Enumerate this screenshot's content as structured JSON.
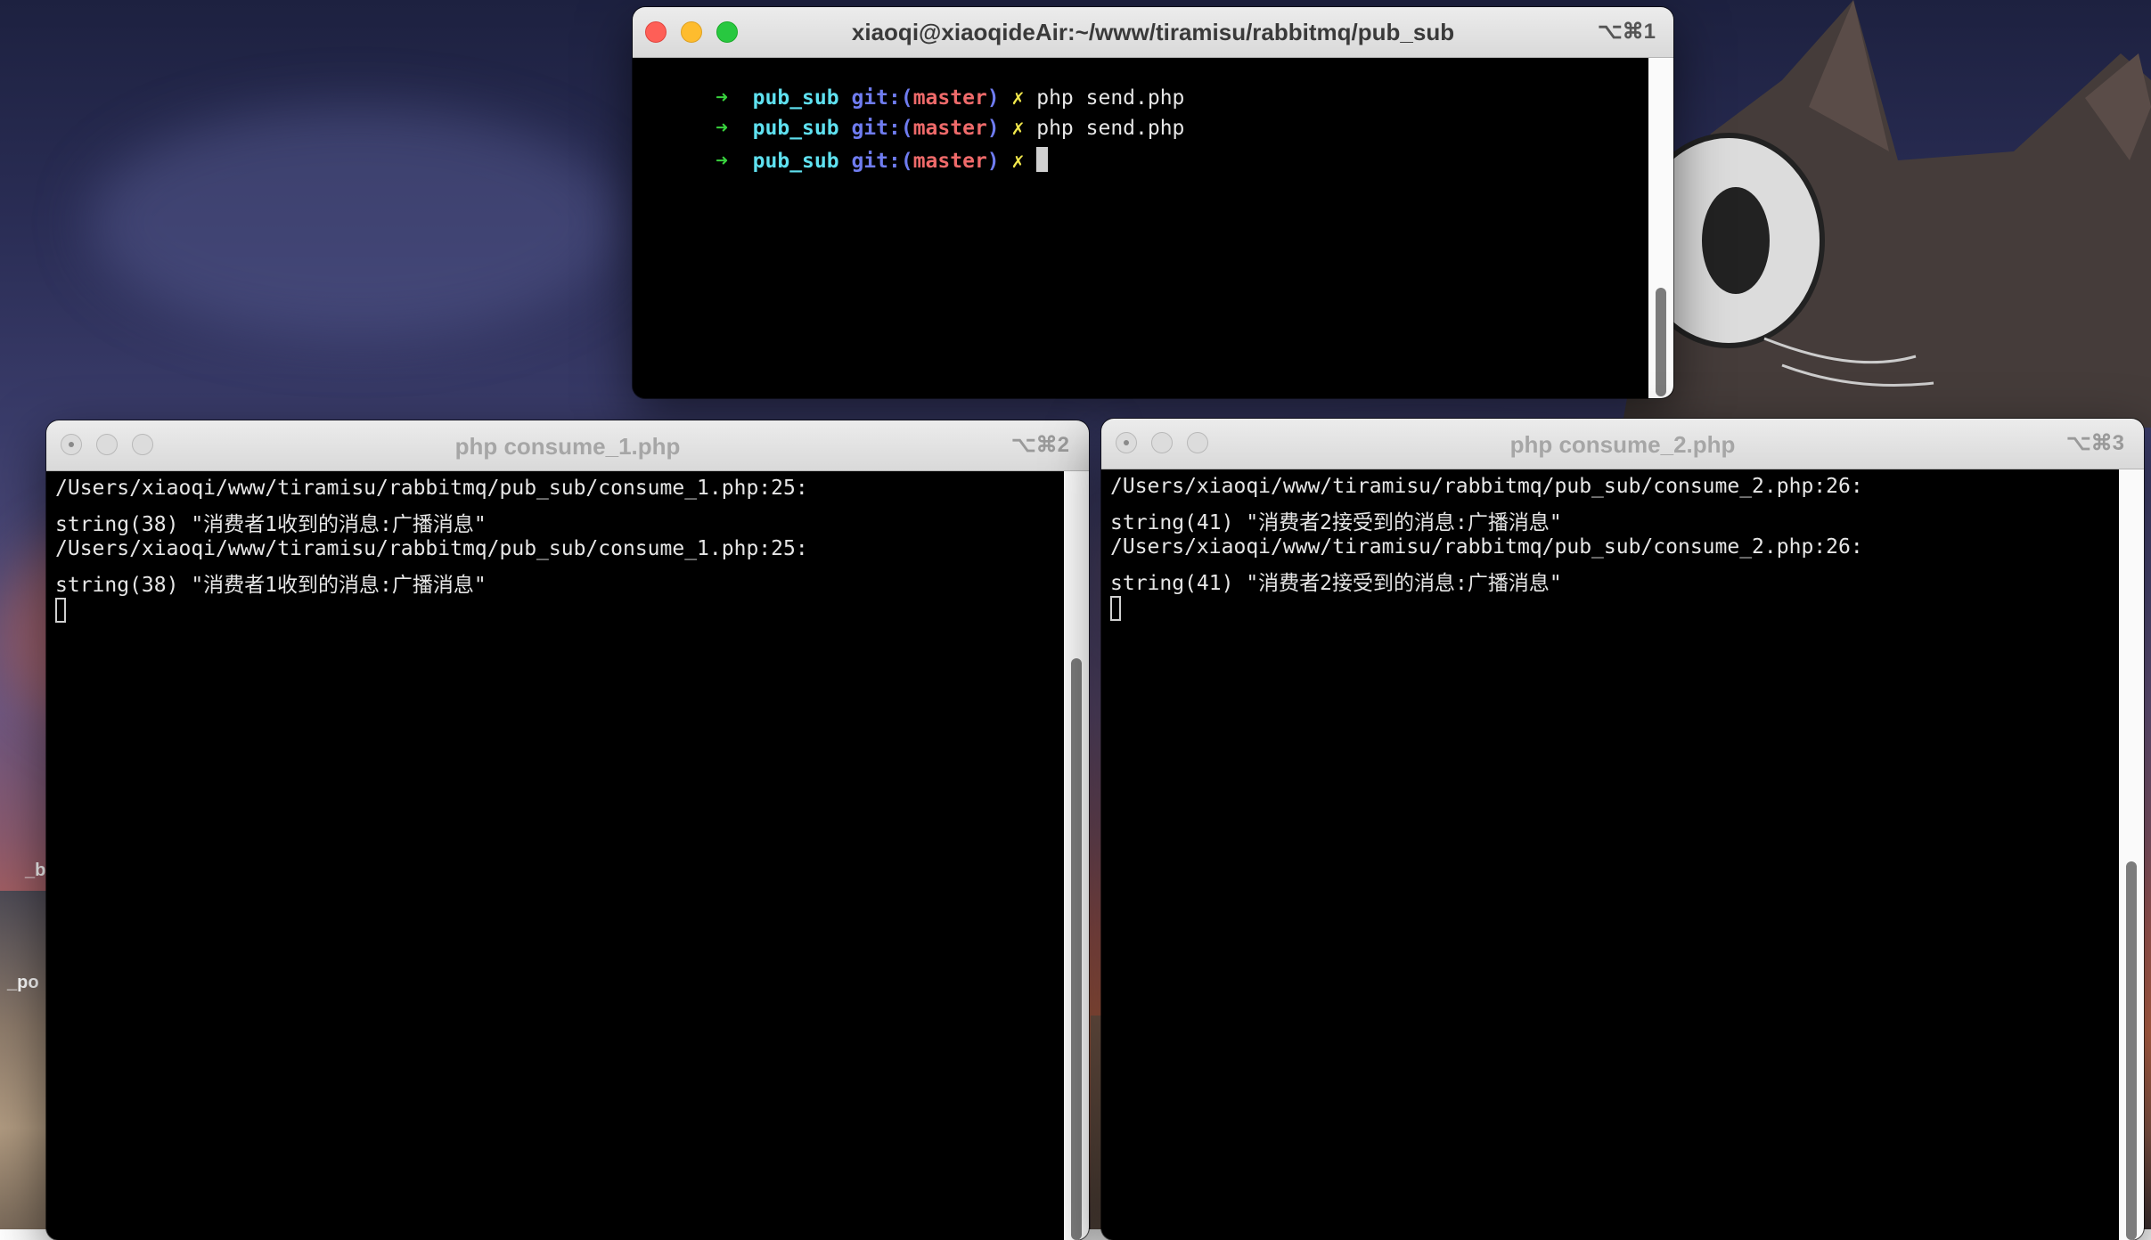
{
  "colors": {
    "arrow": "#38d23d",
    "dir": "#5fe1f0",
    "git": "#6f7cf0",
    "branch": "#ef6a6a",
    "dirty_mark": "#f2e84c",
    "text": "#e6e6e6"
  },
  "icons": {
    "prompt_arrow": "➜",
    "dirty_mark": "✗",
    "close": "close-icon",
    "minimize": "minimize-icon",
    "zoom": "zoom-icon"
  },
  "window1": {
    "title": "xiaoqi@xiaoqideAir:~/www/tiramisu/rabbitmq/pub_sub",
    "shortcut": "⌥⌘1",
    "prompt_dir": "pub_sub",
    "prompt_git": "git:(",
    "prompt_branch": "master",
    "prompt_git_close": ")",
    "lines": [
      {
        "command": "php send.php"
      },
      {
        "command": "php send.php"
      },
      {
        "command": ""
      }
    ]
  },
  "window2": {
    "title": "php consume_1.php",
    "shortcut": "⌥⌘2",
    "lines": [
      "/Users/xiaoqi/www/tiramisu/rabbitmq/pub_sub/consume_1.php:25:",
      "string(38) \"消费者1收到的消息:广播消息\"",
      "/Users/xiaoqi/www/tiramisu/rabbitmq/pub_sub/consume_1.php:25:",
      "string(38) \"消费者1收到的消息:广播消息\""
    ]
  },
  "window3": {
    "title": "php consume_2.php",
    "shortcut": "⌥⌘3",
    "lines": [
      "/Users/xiaoqi/www/tiramisu/rabbitmq/pub_sub/consume_2.php:26:",
      "string(41) \"消费者2接受到的消息:广播消息\"",
      "/Users/xiaoqi/www/tiramisu/rabbitmq/pub_sub/consume_2.php:26:",
      "string(41) \"消费者2接受到的消息:广播消息\""
    ]
  },
  "desktop_labels": [
    "_b",
    "_po"
  ]
}
